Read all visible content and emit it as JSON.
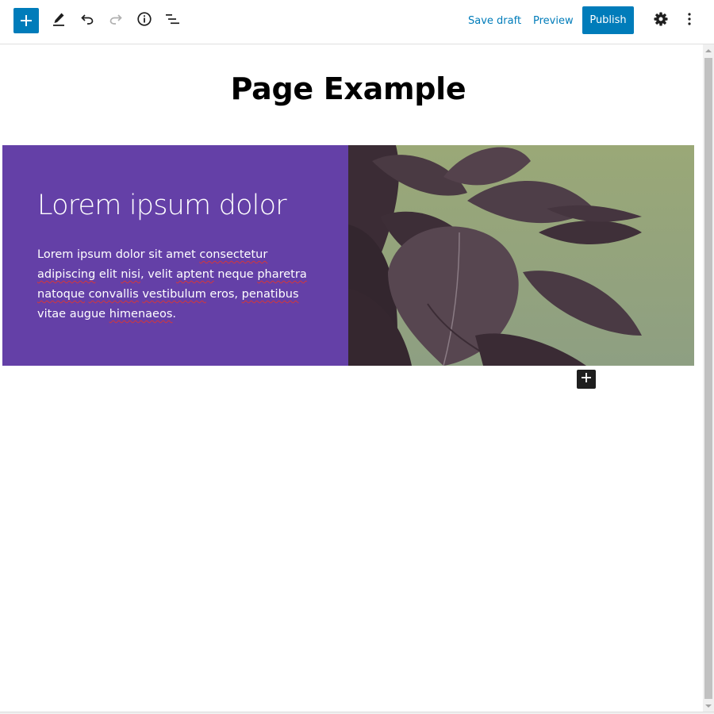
{
  "toolbar": {
    "save_draft_label": "Save draft",
    "preview_label": "Preview",
    "publish_label": "Publish",
    "icons": {
      "inserter": "plus-icon",
      "edit": "pencil-icon",
      "undo": "undo-icon",
      "redo": "redo-icon",
      "info": "info-icon",
      "list_view": "list-view-icon",
      "settings": "gear-icon",
      "more": "more-vertical-icon"
    }
  },
  "editor": {
    "page_title": "Page Example",
    "media_text": {
      "heading": "Lorem ipsum dolor",
      "paragraph": {
        "w1": "Lorem ipsum dolor sit amet ",
        "s1": "consectetur",
        "w2": " ",
        "s2": "adipiscing",
        "w3": " elit ",
        "s3": "nisi",
        "w4": ", velit ",
        "s4": "aptent",
        "w5": " neque ",
        "s5": "pharetra",
        "w6": " ",
        "s6": "natoque",
        "w7": " ",
        "s7": "convallis",
        "w8": " ",
        "s8": "vestibulum",
        "w9": " eros, ",
        "s9": "penatibus",
        "w10": " vitae augue ",
        "s10": "himenaeos",
        "w11": "."
      },
      "background_color": "#6440a7",
      "media_description_icon": "plant-image"
    },
    "appender_icon": "plus-icon"
  },
  "colors": {
    "accent": "#007cba",
    "spellcheck": "#d63638"
  }
}
